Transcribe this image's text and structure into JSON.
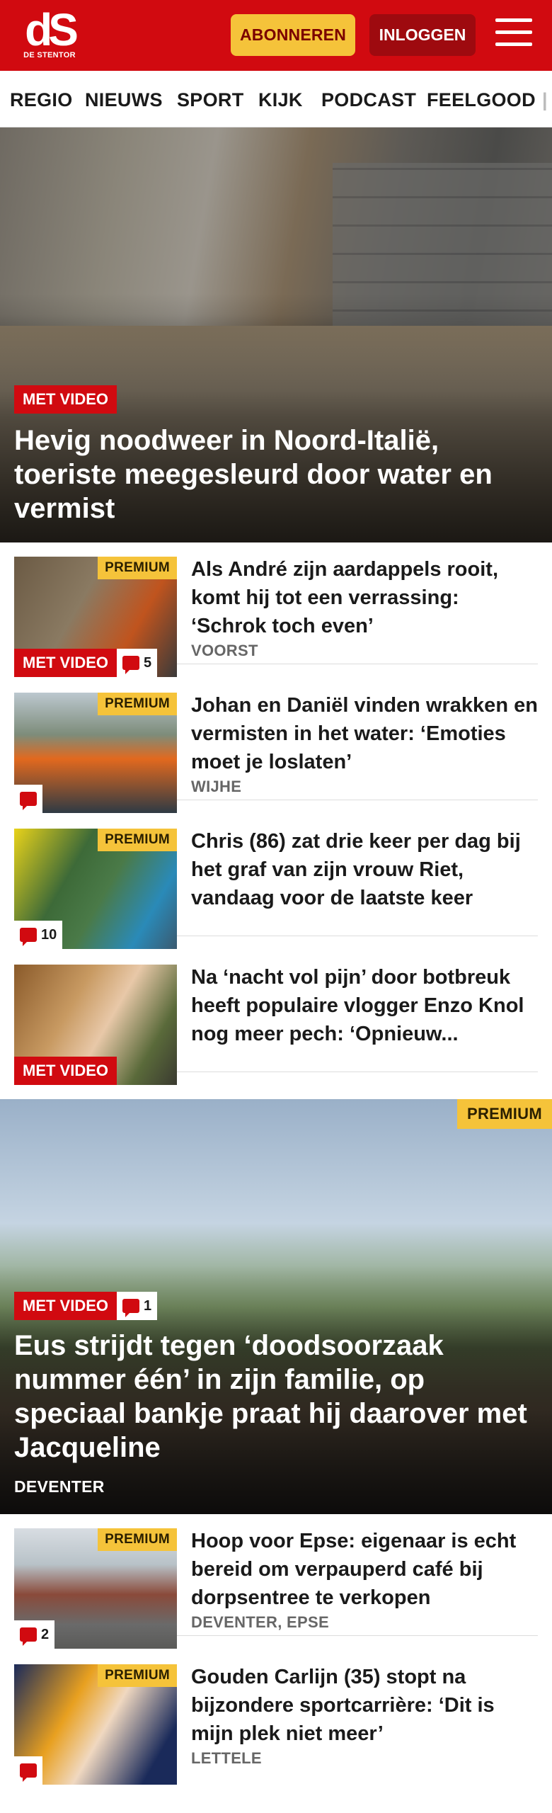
{
  "header": {
    "logo_mark": "dS",
    "logo_sub": "DE STENTOR",
    "subscribe_label": "ABONNEREN",
    "login_label": "INLOGGEN",
    "brand_color": "#d10a10",
    "accent_color": "#f5c33a"
  },
  "nav": {
    "items": [
      "REGIO",
      "NIEUWS",
      "SPORT",
      "KIJK",
      "PODCAST",
      "FEELGOOD"
    ]
  },
  "hero": {
    "badge": "MET VIDEO",
    "title": "Hevig noodweer in Noord-Italië, toeriste meegesleurd door water en vermist"
  },
  "articles": [
    {
      "premium": "PREMIUM",
      "video": "MET VIDEO",
      "comments": "5",
      "title": "Als André zijn aardappels rooit, komt hij tot een verrassing: ‘Schrok toch even’",
      "location": "VOORST"
    },
    {
      "premium": "PREMIUM",
      "comments": "",
      "title": "Johan en Daniël vinden wrakken en vermisten in het water: ‘Emoties moet je loslaten’",
      "location": "WIJHE"
    },
    {
      "premium": "PREMIUM",
      "comments": "10",
      "title": "Chris (86) zat drie keer per dag bij het graf van zijn vrouw Riet, vandaag voor de laatste keer",
      "location": ""
    },
    {
      "video": "MET VIDEO",
      "title": "Na ‘nacht vol pijn’ door botbreuk heeft populaire vlogger Enzo Knol nog meer pech: ‘Opnieuw...",
      "location": ""
    }
  ],
  "feature": {
    "premium": "PREMIUM",
    "video": "MET VIDEO",
    "comments": "1",
    "title": "Eus strijdt tegen ‘doodsoorzaak nummer één’ in zijn familie, op speciaal bankje praat hij daarover met Jacqueline",
    "location": "DEVENTER"
  },
  "articles2": [
    {
      "premium": "PREMIUM",
      "comments": "2",
      "title": "Hoop voor Epse: eigenaar is echt bereid om verpauperd café bij dorpsentree te verkopen",
      "location": "DEVENTER, EPSE"
    },
    {
      "premium": "PREMIUM",
      "comments": "",
      "title": "Gouden Carlijn (35) stopt na bijzondere sportcarrière: ‘Dit is mijn plek niet meer’",
      "location": "LETTELE"
    }
  ]
}
